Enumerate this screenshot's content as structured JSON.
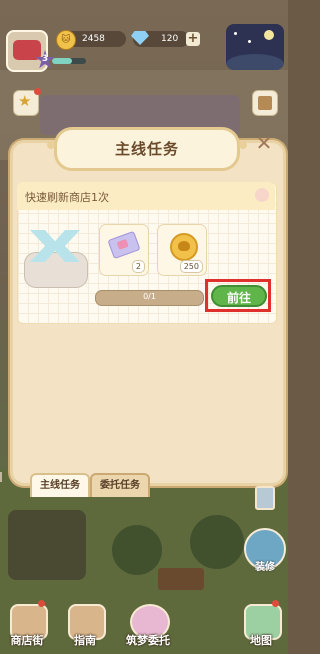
{
  "hud": {
    "level": "3",
    "coins": "2458",
    "gems": "120",
    "xp_fraction": 0.6
  },
  "dialog": {
    "title": "主线任务",
    "task_name": "快速刷新商店1次",
    "rewards": [
      {
        "icon": "ticket-icon",
        "count": "2"
      },
      {
        "icon": "cat-coin-icon",
        "count": "250"
      }
    ],
    "progress_text": "0/1",
    "progress_fraction": 0,
    "go_label": "前往",
    "tabs": [
      "主线任务",
      "委托任务"
    ],
    "active_tab": 0
  },
  "side": {
    "repair_label": "装修"
  },
  "bottom_nav": {
    "items": [
      {
        "label": "商店街",
        "icon": "shop-street-icon"
      },
      {
        "label": "指南",
        "icon": "guide-icon"
      },
      {
        "label": "筑梦委托",
        "icon": "dream-commission-icon"
      },
      {
        "label": "地图",
        "icon": "map-icon"
      }
    ]
  },
  "colors": {
    "accent_green": "#5fb44a",
    "highlight_red": "#e0302e",
    "panel_cream": "#f3e3c4"
  }
}
